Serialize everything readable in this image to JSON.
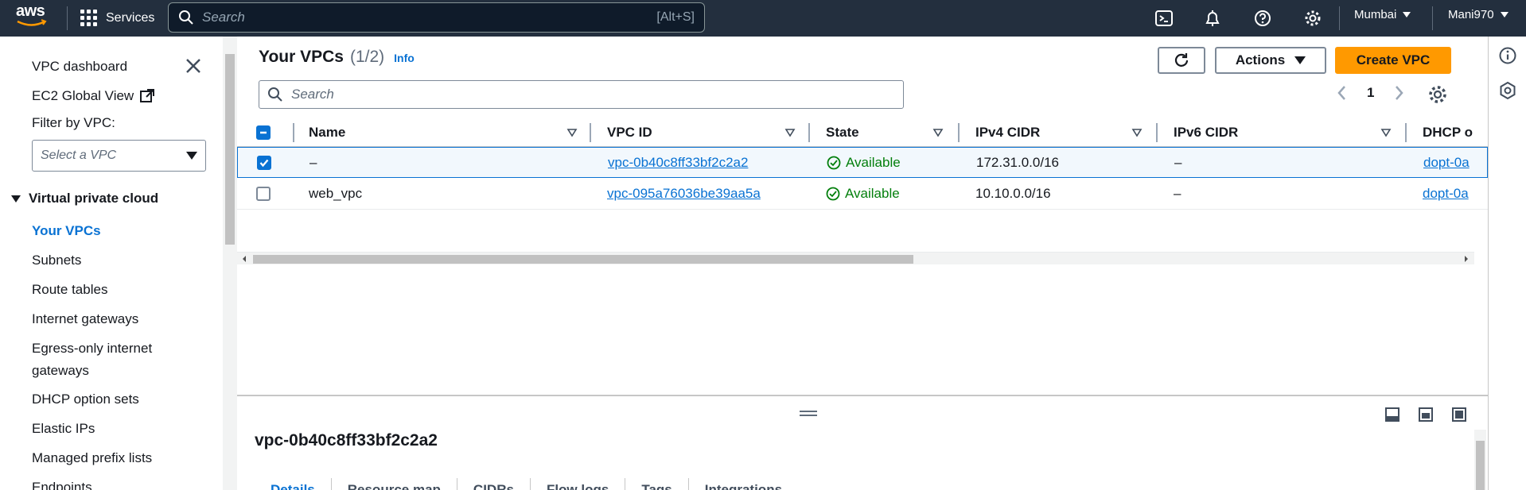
{
  "topnav": {
    "logo": "aws",
    "services_label": "Services",
    "search_placeholder": "Search",
    "search_shortcut": "[Alt+S]",
    "region": "Mumbai",
    "account": "Mani970",
    "icons": [
      "cloudshell-icon",
      "notifications-icon",
      "help-icon",
      "settings-icon"
    ]
  },
  "sidebar": {
    "top_links": [
      "VPC dashboard",
      "EC2 Global View"
    ],
    "filter_label": "Filter by VPC:",
    "filter_placeholder": "Select a VPC",
    "section_title": "Virtual private cloud",
    "items": [
      {
        "label": "Your VPCs",
        "active": true
      },
      {
        "label": "Subnets"
      },
      {
        "label": "Route tables"
      },
      {
        "label": "Internet gateways"
      },
      {
        "label": "Egress-only internet gateways"
      },
      {
        "label": "DHCP option sets"
      },
      {
        "label": "Elastic IPs"
      },
      {
        "label": "Managed prefix lists"
      },
      {
        "label": "Endpoints"
      }
    ]
  },
  "main": {
    "title": "Your VPCs",
    "count": "(1/2)",
    "info": "Info",
    "actions_label": "Actions",
    "create_label": "Create VPC",
    "search_placeholder": "Search",
    "page_number": "1"
  },
  "table": {
    "columns": [
      "Name",
      "VPC ID",
      "State",
      "IPv4 CIDR",
      "IPv6 CIDR",
      "DHCP o"
    ],
    "rows": [
      {
        "selected": true,
        "name": "–",
        "vpc_id": "vpc-0b40c8ff33bf2c2a2",
        "state": "Available",
        "ipv4": "172.31.0.0/16",
        "ipv6": "–",
        "dhcp": "dopt-0a"
      },
      {
        "selected": false,
        "name": "web_vpc",
        "vpc_id": "vpc-095a76036be39aa5a",
        "state": "Available",
        "ipv4": "10.10.0.0/16",
        "ipv6": "–",
        "dhcp": "dopt-0a"
      }
    ]
  },
  "detail": {
    "title": "vpc-0b40c8ff33bf2c2a2",
    "tabs": [
      "Details",
      "Resource map",
      "CIDRs",
      "Flow logs",
      "Tags",
      "Integrations"
    ]
  },
  "colors": {
    "nav_bg": "#232f3e",
    "accent": "#0972d3",
    "primary_button": "#ff9900",
    "success": "#037f0c"
  }
}
